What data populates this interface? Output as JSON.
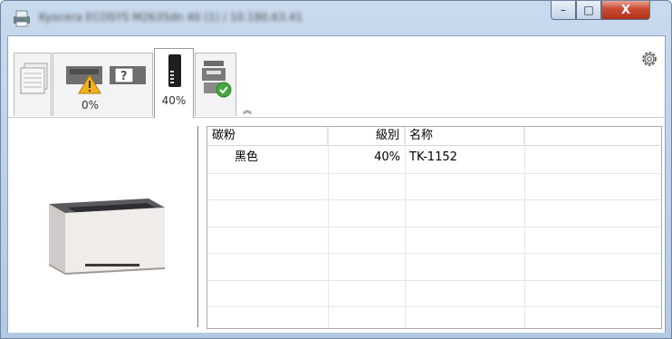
{
  "window": {
    "title": "Kyocera ECOSYS M2635dn 40 (1) / 10.180.63.41",
    "minimize_glyph": "–",
    "maximize_glyph": "□",
    "close_glyph": "X"
  },
  "tabs": [
    {
      "name": "paper",
      "icon": "paper-stack-icon",
      "label": ""
    },
    {
      "name": "warning",
      "icon": "printer-warning-icon",
      "label": "0%"
    },
    {
      "name": "toner",
      "icon": "toner-cartridge-icon",
      "label": "40%",
      "active": true
    },
    {
      "name": "device",
      "icon": "device-status-ok-icon",
      "label": ""
    }
  ],
  "toolbar": {
    "collapse_glyph": "︽",
    "settings_icon": "gear-icon"
  },
  "toner_table": {
    "columns": [
      "碳粉",
      "級別",
      "名称"
    ],
    "rows": [
      {
        "color": "黑色",
        "level": "40%",
        "name": "TK-1152"
      }
    ]
  },
  "colors": {
    "title_gradient_top": "#c9daee",
    "close_red": "#c7492f",
    "warning_yellow": "#f2b21b",
    "ok_green": "#44a83d"
  }
}
